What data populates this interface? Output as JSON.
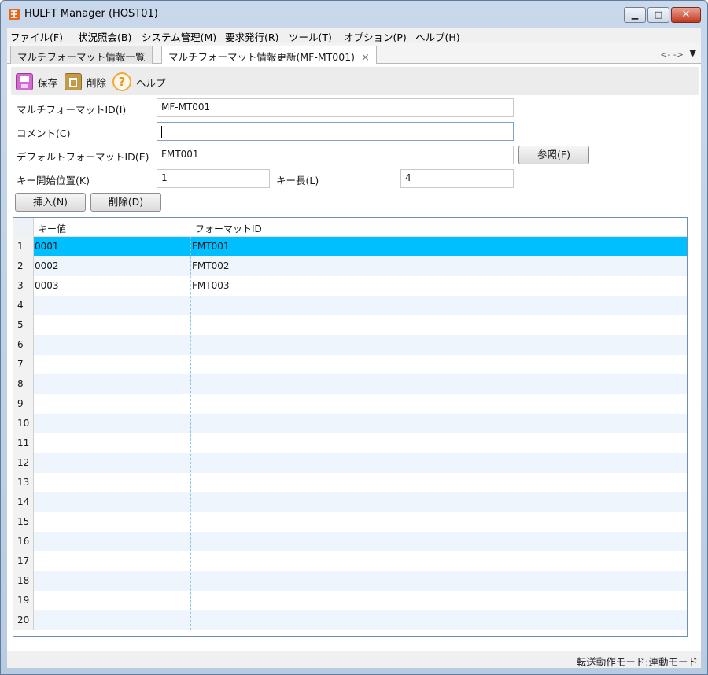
{
  "window": {
    "title": "HULFT Manager (HOST01)"
  },
  "menu": [
    "ファイル(F)",
    "状況照会(B)",
    "システム管理(M)",
    "要求発行(R)",
    "ツール(T)",
    "オプション(P)",
    "ヘルプ(H)"
  ],
  "tabs": [
    {
      "label": "マルチフォーマット情報一覧",
      "active": false
    },
    {
      "label": "マルチフォーマット情報更新(MF-MT001)",
      "active": true,
      "close": "×"
    }
  ],
  "tab_nav": "<- ->",
  "toolbar": {
    "save": "保存",
    "delete": "削除",
    "help": "ヘルプ"
  },
  "form": {
    "multiformat_id_label": "マルチフォーマットID(I)",
    "multiformat_id_value": "MF-MT001",
    "comment_label": "コメント(C)",
    "comment_value": "",
    "default_format_label": "デフォルトフォーマットID(E)",
    "default_format_value": "FMT001",
    "browse_button": "参照(F)",
    "key_start_label": "キー開始位置(K)",
    "key_start_value": "1",
    "key_length_label": "キー長(L)",
    "key_length_value": "4",
    "insert_button": "挿入(N)",
    "delete_button": "削除(D)"
  },
  "grid": {
    "columns": [
      "キー値",
      "フォーマットID"
    ],
    "row_numbers": [
      "1",
      "2",
      "3",
      "4",
      "5",
      "6",
      "7",
      "8",
      "9",
      "10",
      "11",
      "12",
      "13",
      "14",
      "15",
      "16",
      "17",
      "18",
      "19",
      "20"
    ],
    "rows": [
      [
        "0001",
        "FMT001"
      ],
      [
        "0002",
        "FMT002"
      ],
      [
        "0003",
        "FMT003"
      ]
    ],
    "selected_row": 1,
    "selected_color": "#00bfff"
  },
  "status": {
    "text": "転送動作モード:連動モード"
  }
}
